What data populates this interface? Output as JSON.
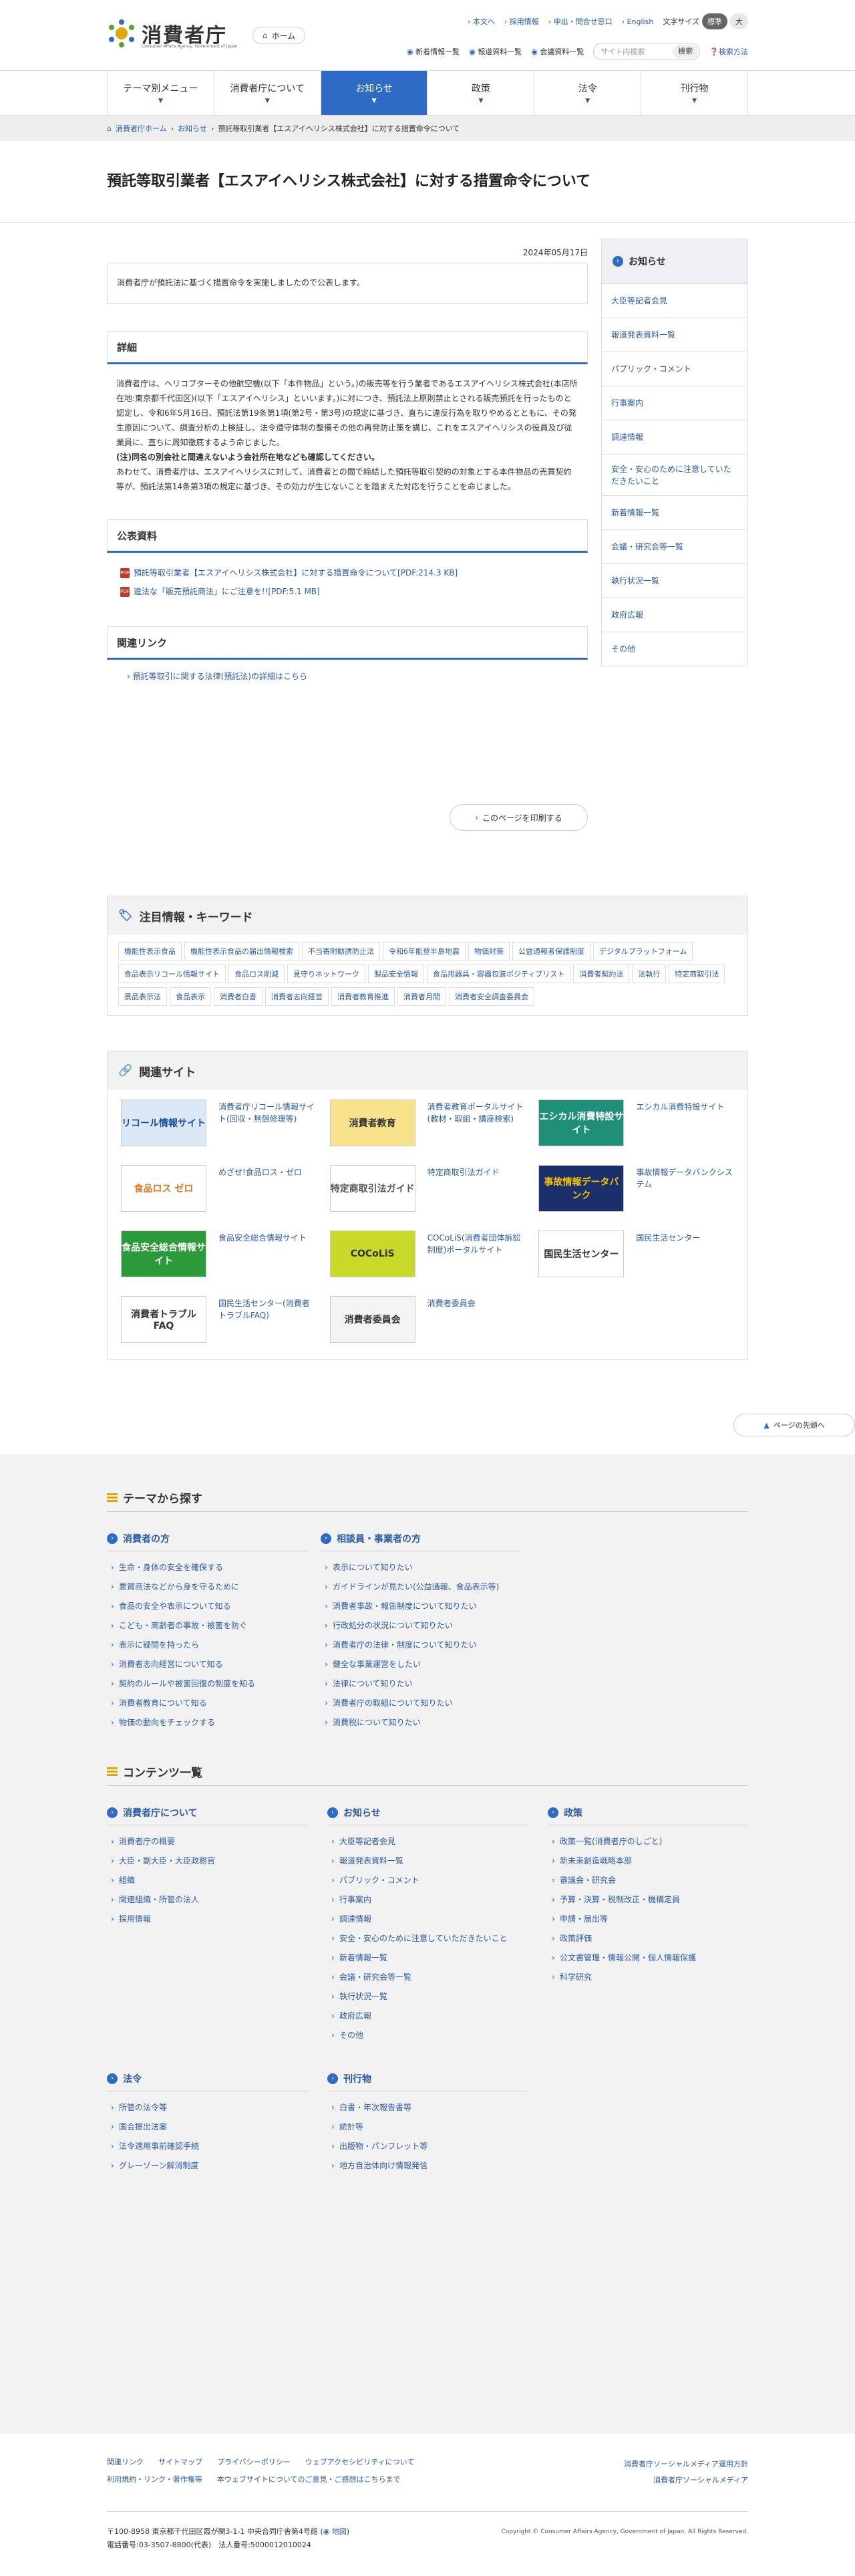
{
  "header": {
    "logo_text": "消費者庁",
    "logo_sub": "Consumer Affairs Agency, Government of Japan",
    "home": "ホーム",
    "toplinks": [
      "本文へ",
      "採用情報",
      "申出・問合せ窓口",
      "English"
    ],
    "fontsize_label": "文字サイズ",
    "fontsize_std": "標準",
    "fontsize_large": "大",
    "feeds": [
      "新着情報一覧",
      "報道資料一覧",
      "会議資料一覧"
    ],
    "search_placeholder": "サイト内検索",
    "search_btn": "検索",
    "search_method": "検索方法"
  },
  "nav": [
    "テーマ別メニュー",
    "消費者庁について",
    "お知らせ",
    "政策",
    "法令",
    "刊行物"
  ],
  "breadcrumb": [
    "消費者庁ホーム",
    "お知らせ",
    "預託等取引業者【エスアイヘリシス株式会社】に対する措置命令について"
  ],
  "title": "預託等取引業者【エスアイヘリシス株式会社】に対する措置命令について",
  "date": "2024年05月17日",
  "lead": "消費者庁が預託法に基づく措置命令を実施しましたので公表します。",
  "details": {
    "heading": "詳細",
    "p1": "消費者庁は、ヘリコプターその他航空機(以下「本件物品」という。)の販売等を行う業者であるエスアイヘリシス株式会社(本店所在地:東京都千代田区)(以下「エスアイヘリシス」といいます。)に対につき、預託法上原則禁止とされる販売預託を行ったものと認定し、令和6年5月16日、預託法第19条第1項(第2号・第3号)の規定に基づき、直ちに違反行為を取りやめるとともに、その発生原因について、調査分析の上検証し、法令遵守体制の整備その他の再発防止策を講じ、これをエスアイヘリシスの役員及び従業員に、直ちに周知徹底するよう命じました。",
    "p2": "(注)同名の別会社と間違えないよう会社所在地なども確認してください。",
    "p3": "あわせて、消費者庁は、エスアイヘリシスに対して、消費者との間で締結した預託等取引契約の対象とする本件物品の売買契約等が、預託法第14条第3項の規定に基づき、その効力が生じないことを踏まえた対応を行うことを命じました。"
  },
  "press": {
    "heading": "公表資料",
    "files": [
      "預託等取引業者【エスアイヘリシス株式会社】に対する措置命令について[PDF:214.3 KB]",
      "違法な「販売預託商法」にご注意を!![PDF:5.1 MB]"
    ],
    "pdf_tag": "PDF"
  },
  "related": {
    "heading": "関連リンク",
    "link": "預託等取引に関する法律(預託法)の詳細はこちら"
  },
  "print": "このページを印刷する",
  "side": {
    "heading": "お知らせ",
    "items": [
      "大臣等記者会見",
      "報道発表資料一覧",
      "パブリック・コメント",
      "行事案内",
      "調達情報",
      "安全・安心のために注意していただきたいこと",
      "新着情報一覧",
      "会議・研究会等一覧",
      "執行状況一覧",
      "政府広報",
      "その他"
    ]
  },
  "keywords": {
    "heading": "注目情報・キーワード",
    "items": [
      "機能性表示食品",
      "機能性表示食品の届出情報検索",
      "不当寄附勧誘防止法",
      "令和6年能登半島地震",
      "物価対策",
      "公益通報者保護制度",
      "デジタルプラットフォーム",
      "食品表示リコール情報サイト",
      "食品ロス削減",
      "見守りネットワーク",
      "製品安全情報",
      "食品用器具・容器包装ポジティブリスト",
      "消費者契約法",
      "法執行",
      "特定商取引法",
      "景品表示法",
      "食品表示",
      "消費者白書",
      "消費者志向経営",
      "消費者教育推進",
      "消費者月間",
      "消費者安全調査委員会"
    ]
  },
  "sites": {
    "heading": "関連サイト",
    "items": [
      {
        "banner": "リコール情報サイト",
        "label": "消費者庁リコール情報サイト(回収・無償修理等)",
        "bg": "#dbe9f7",
        "fg": "#1a4fa0"
      },
      {
        "banner": "消費者教育",
        "label": "消費者教育ポータルサイト(教材・取組・講座検索)",
        "bg": "#f6e28a",
        "fg": "#333"
      },
      {
        "banner": "エシカル消費特設サイト",
        "label": "エシカル消費特設サイト",
        "bg": "#1f8f7a",
        "fg": "#fff"
      },
      {
        "banner": "食品ロス ゼロ",
        "label": "めざせ!食品ロス・ゼロ",
        "bg": "#fff",
        "fg": "#e07a1f"
      },
      {
        "banner": "特定商取引法ガイド",
        "label": "特定商取引法ガイド",
        "bg": "#fff",
        "fg": "#555"
      },
      {
        "banner": "事故情報データバンク",
        "label": "事故情報データバンクシステム",
        "bg": "#1b2f6b",
        "fg": "#f5c400"
      },
      {
        "banner": "食品安全総合情報サイト",
        "label": "食品安全総合情報サイト",
        "bg": "#2c9a3a",
        "fg": "#fff"
      },
      {
        "banner": "COCoLiS",
        "label": "COCoLiS(消費者団体訴訟制度)ポータルサイト",
        "bg": "#c8d92a",
        "fg": "#333"
      },
      {
        "banner": "国民生活センター",
        "label": "国民生活センター",
        "bg": "#fff",
        "fg": "#333"
      },
      {
        "banner": "消費者トラブルFAQ",
        "label": "国民生活センター(消費者トラブルFAQ)",
        "bg": "#fff",
        "fg": "#333"
      },
      {
        "banner": "消費者委員会",
        "label": "消費者委員会",
        "bg": "#f4f4f4",
        "fg": "#333"
      }
    ]
  },
  "to_top": "ページの先頭へ",
  "theme": {
    "heading": "テーマから探す",
    "left": {
      "heading": "消費者の方",
      "items": [
        "生命・身体の安全を確保する",
        "悪質商法などから身を守るために",
        "食品の安全や表示について知る",
        "こども・高齢者の事故・被害を防ぐ",
        "表示に疑問を持ったら",
        "消費者志向経営について知る",
        "契約のルールや被害回復の制度を知る",
        "消費者教育について知る",
        "物価の動向をチェックする"
      ]
    },
    "right": {
      "heading": "相談員・事業者の方",
      "items": [
        "表示について知りたい",
        "ガイドラインが見たい(公益通報、食品表示等)",
        "消費者事故・報告制度について知りたい",
        "行政処分の状況について知りたい",
        "消費者庁の法律・制度について知りたい",
        "健全な事業運営をしたい",
        "法律について知りたい",
        "消費者庁の取組について知りたい",
        "消費税について知りたい"
      ]
    }
  },
  "contents": {
    "heading": "コンテンツ一覧",
    "cols": [
      {
        "heading": "消費者庁について",
        "items": [
          "消費者庁の概要",
          "大臣・副大臣・大臣政務官",
          "組織",
          "関連組織・所管の法人",
          "採用情報"
        ]
      },
      {
        "heading": "お知らせ",
        "items": [
          "大臣等記者会見",
          "報道発表資料一覧",
          "パブリック・コメント",
          "行事案内",
          "調達情報",
          "安全・安心のために注意していただきたいこと",
          "新着情報一覧",
          "会議・研究会等一覧",
          "執行状況一覧",
          "政府広報",
          "その他"
        ]
      },
      {
        "heading": "政策",
        "items": [
          "政策一覧(消費者庁のしごと)",
          "新未来創造戦略本部",
          "審議会・研究会",
          "予算・決算・税制改正・機構定員",
          "申請・届出等",
          "政策評価",
          "公文書管理・情報公開・個人情報保護",
          "科学研究"
        ]
      },
      {
        "heading": "法令",
        "items": [
          "所管の法令等",
          "国会提出法案",
          "法令適用事前確認手続",
          "グレーゾーン解消制度"
        ]
      },
      {
        "heading": "刊行物",
        "items": [
          "白書・年次報告書等",
          "統計等",
          "出版物・パンフレット等",
          "地方自治体向け情報発信"
        ]
      }
    ]
  },
  "footer": {
    "links1": [
      "関連リンク",
      "サイトマップ",
      "プライバシーポリシー",
      "ウェブアクセシビリティについて"
    ],
    "links2": [
      "利用規約・リンク・著作権等",
      "本ウェブサイトについてのご意見・ご感想はこちらまで"
    ],
    "sns1": "消費者庁ソーシャルメディア運用方針",
    "sns2": "消費者庁ソーシャルメディア",
    "address": "〒100-8958 東京都千代田区霞が関3-1-1 中央合同庁舎第4号館",
    "map": "地図",
    "tel": "電話番号:03-3507-8800(代表)",
    "corp": "法人番号:5000012010024",
    "copyright": "Copyright © Consumer Affairs Agency, Government of Japan. All Rights Reserved."
  },
  "colors": {
    "accent": "#2d6bc4",
    "link": "#2a5aa6"
  }
}
